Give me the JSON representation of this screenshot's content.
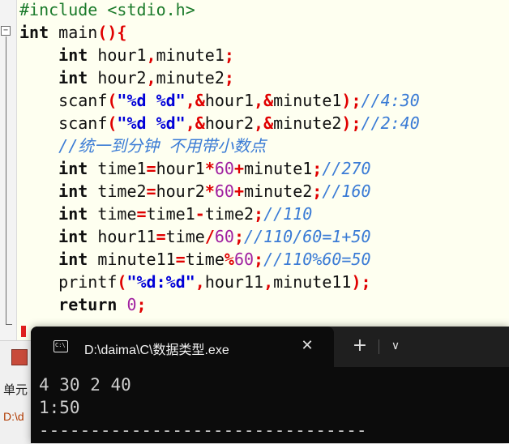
{
  "editor": {
    "fold_symbol": "−",
    "lines": [
      [
        {
          "c": "pp",
          "t": "#include <stdio.h>"
        }
      ],
      [
        {
          "c": "kw",
          "t": "int"
        },
        {
          "c": "id",
          "t": " main"
        },
        {
          "c": "op",
          "t": "(){"
        }
      ],
      [
        {
          "c": "id",
          "t": "    "
        },
        {
          "c": "kw",
          "t": "int"
        },
        {
          "c": "id",
          "t": " hour1"
        },
        {
          "c": "op",
          "t": ","
        },
        {
          "c": "id",
          "t": "minute1"
        },
        {
          "c": "op",
          "t": ";"
        }
      ],
      [
        {
          "c": "id",
          "t": "    "
        },
        {
          "c": "kw",
          "t": "int"
        },
        {
          "c": "id",
          "t": " hour2"
        },
        {
          "c": "op",
          "t": ","
        },
        {
          "c": "id",
          "t": "minute2"
        },
        {
          "c": "op",
          "t": ";"
        }
      ],
      [
        {
          "c": "id",
          "t": "    scanf"
        },
        {
          "c": "op",
          "t": "("
        },
        {
          "c": "str",
          "t": "\"%d %d\""
        },
        {
          "c": "op",
          "t": ",&"
        },
        {
          "c": "id",
          "t": "hour1"
        },
        {
          "c": "op",
          "t": ",&"
        },
        {
          "c": "id",
          "t": "minute1"
        },
        {
          "c": "op",
          "t": ");"
        },
        {
          "c": "cm",
          "t": "//4:30"
        }
      ],
      [
        {
          "c": "id",
          "t": "    scanf"
        },
        {
          "c": "op",
          "t": "("
        },
        {
          "c": "str",
          "t": "\"%d %d\""
        },
        {
          "c": "op",
          "t": ",&"
        },
        {
          "c": "id",
          "t": "hour2"
        },
        {
          "c": "op",
          "t": ",&"
        },
        {
          "c": "id",
          "t": "minute2"
        },
        {
          "c": "op",
          "t": ");"
        },
        {
          "c": "cm",
          "t": "//2:40"
        }
      ],
      [
        {
          "c": "id",
          "t": "    "
        },
        {
          "c": "cm",
          "t": "//统一到分钟 不用带小数点"
        }
      ],
      [
        {
          "c": "id",
          "t": "    "
        },
        {
          "c": "kw",
          "t": "int"
        },
        {
          "c": "id",
          "t": " time1"
        },
        {
          "c": "op",
          "t": "="
        },
        {
          "c": "id",
          "t": "hour1"
        },
        {
          "c": "op",
          "t": "*"
        },
        {
          "c": "num",
          "t": "60"
        },
        {
          "c": "op",
          "t": "+"
        },
        {
          "c": "id",
          "t": "minute1"
        },
        {
          "c": "op",
          "t": ";"
        },
        {
          "c": "cm",
          "t": "//270"
        }
      ],
      [
        {
          "c": "id",
          "t": "    "
        },
        {
          "c": "kw",
          "t": "int"
        },
        {
          "c": "id",
          "t": " time2"
        },
        {
          "c": "op",
          "t": "="
        },
        {
          "c": "id",
          "t": "hour2"
        },
        {
          "c": "op",
          "t": "*"
        },
        {
          "c": "num",
          "t": "60"
        },
        {
          "c": "op",
          "t": "+"
        },
        {
          "c": "id",
          "t": "minute2"
        },
        {
          "c": "op",
          "t": ";"
        },
        {
          "c": "cm",
          "t": "//160"
        }
      ],
      [
        {
          "c": "id",
          "t": "    "
        },
        {
          "c": "kw",
          "t": "int"
        },
        {
          "c": "id",
          "t": " time"
        },
        {
          "c": "op",
          "t": "="
        },
        {
          "c": "id",
          "t": "time1"
        },
        {
          "c": "op",
          "t": "-"
        },
        {
          "c": "id",
          "t": "time2"
        },
        {
          "c": "op",
          "t": ";"
        },
        {
          "c": "cm",
          "t": "//110"
        }
      ],
      [
        {
          "c": "id",
          "t": "    "
        },
        {
          "c": "kw",
          "t": "int"
        },
        {
          "c": "id",
          "t": " hour11"
        },
        {
          "c": "op",
          "t": "="
        },
        {
          "c": "id",
          "t": "time"
        },
        {
          "c": "op",
          "t": "/"
        },
        {
          "c": "num",
          "t": "60"
        },
        {
          "c": "op",
          "t": ";"
        },
        {
          "c": "cm",
          "t": "//110/60=1+50"
        }
      ],
      [
        {
          "c": "id",
          "t": "    "
        },
        {
          "c": "kw",
          "t": "int"
        },
        {
          "c": "id",
          "t": " minute11"
        },
        {
          "c": "op",
          "t": "="
        },
        {
          "c": "id",
          "t": "time"
        },
        {
          "c": "op",
          "t": "%"
        },
        {
          "c": "num",
          "t": "60"
        },
        {
          "c": "op",
          "t": ";"
        },
        {
          "c": "cm",
          "t": "//110%60=50"
        }
      ],
      [
        {
          "c": "id",
          "t": "    printf"
        },
        {
          "c": "op",
          "t": "("
        },
        {
          "c": "str",
          "t": "\"%d:%d\""
        },
        {
          "c": "op",
          "t": ","
        },
        {
          "c": "id",
          "t": "hour11"
        },
        {
          "c": "op",
          "t": ","
        },
        {
          "c": "id",
          "t": "minute11"
        },
        {
          "c": "op",
          "t": ");"
        }
      ],
      [
        {
          "c": "id",
          "t": "    "
        },
        {
          "c": "kw",
          "t": "return"
        },
        {
          "c": "id",
          "t": " "
        },
        {
          "c": "num",
          "t": "0"
        },
        {
          "c": "op",
          "t": ";"
        }
      ]
    ]
  },
  "ide": {
    "label_1": "单元",
    "label_2": "D:\\d"
  },
  "terminal": {
    "icon_text": "C:\\",
    "tab_title": "D:\\daima\\C\\数据类型.exe",
    "close_glyph": "✕",
    "new_tab_glyph": "+",
    "dropdown_glyph": "∨",
    "output": [
      "4 30 2 40",
      "1:50",
      "--------------------------------"
    ]
  },
  "colors": {
    "editor_bg": "#fefff0",
    "keyword": "#111111",
    "operator": "#e00000",
    "string": "#0000d8",
    "number": "#a020a0",
    "comment": "#3a7bd5",
    "preprocessor": "#1a7a2a",
    "terminal_bg": "#0c0c0c",
    "terminal_text": "#cccccc"
  }
}
